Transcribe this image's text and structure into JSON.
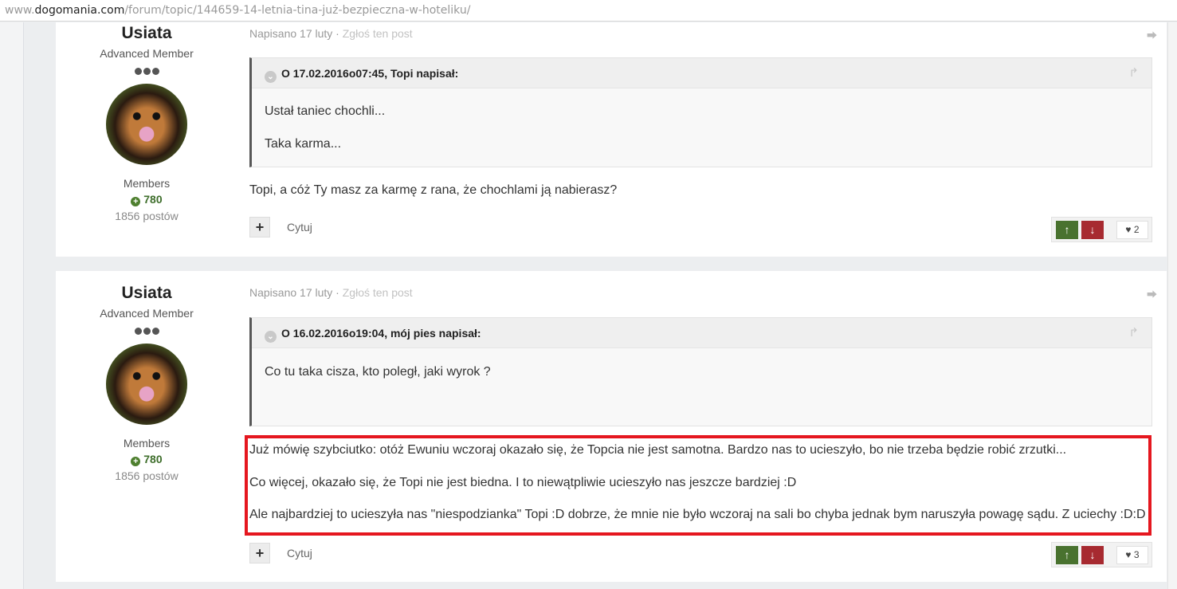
{
  "browser": {
    "url_scheme": "www.",
    "url_host": "dogomania.com",
    "url_path": "/forum/topic/144659-14-letnia-tina-już-bezpieczna-w-hoteliku/"
  },
  "posts": [
    {
      "author": {
        "name": "Usiata",
        "rank": "Advanced Member",
        "group": "Members",
        "reputation": "780",
        "post_count": "1856 postów"
      },
      "posted": "Napisano 17 luty",
      "separator": " · ",
      "report": "Zgłoś ten post",
      "quote": {
        "header": "O 17.02.2016o07:45, Topi napisał:",
        "lines": [
          "Ustał taniec chochli...",
          "Taka karma..."
        ]
      },
      "body": [
        "Topi, a cóż Ty masz za karmę z rana, że chochlami ją nabierasz?"
      ],
      "quote_button": "Cytuj",
      "like_count": "2"
    },
    {
      "author": {
        "name": "Usiata",
        "rank": "Advanced Member",
        "group": "Members",
        "reputation": "780",
        "post_count": "1856 postów"
      },
      "posted": "Napisano 17 luty",
      "separator": " · ",
      "report": "Zgłoś ten post",
      "quote": {
        "header": "O 16.02.2016o19:04, mój pies napisał:",
        "lines": [
          "Co tu taka cisza, kto poległ, jaki wyrok ?"
        ]
      },
      "body": [
        "Już mówię szybciutko: otóż Ewuniu wczoraj okazało się, że Topcia nie jest samotna. Bardzo nas to ucieszyło, bo nie trzeba będzie robić zrzutki...",
        "Co więcej, okazało się, że Topi nie jest biedna. I to niewątpliwie ucieszyło nas jeszcze bardziej :D",
        "Ale najbardziej to ucieszyła nas \"niespodzianka\" Topi :D dobrze, że mnie nie było wczoraj na sali bo chyba jednak bym naruszyła powagę sądu. Z uciechy :D:D"
      ],
      "quote_button": "Cytuj",
      "like_count": "3"
    }
  ],
  "icons": {
    "share": "share-icon",
    "chevron": "chevron-down-icon",
    "plus": "plus-icon",
    "upvote": "arrow-up-icon",
    "downvote": "arrow-down-icon",
    "heart": "heart-icon",
    "reputation": "plus-circle-icon"
  },
  "colors": {
    "highlight_border": "#e5171f",
    "upvote": "#49722f",
    "downvote": "#a72a30",
    "reputation": "#3e6e2b"
  }
}
